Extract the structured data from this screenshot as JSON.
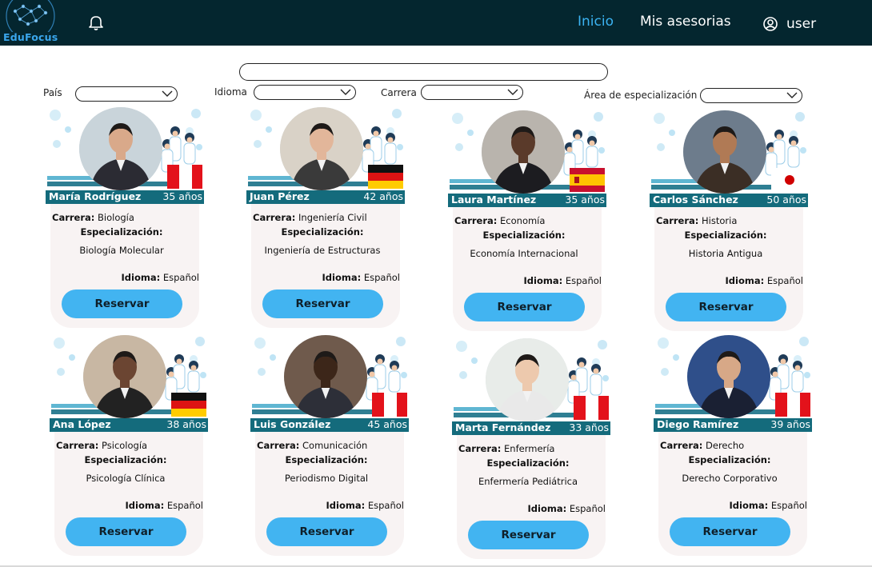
{
  "app": {
    "logo_text": "EduFocus"
  },
  "nav": {
    "inicio": "Inicio",
    "mis_asesorias": "Mis asesorias",
    "user": "user"
  },
  "search": {
    "value": "",
    "placeholder": ""
  },
  "filters": {
    "pais": {
      "label": "País",
      "value": ""
    },
    "idioma": {
      "label": "Idioma",
      "value": ""
    },
    "carrera": {
      "label": "Carrera",
      "value": ""
    },
    "area": {
      "label": "Área de especialización",
      "value": ""
    }
  },
  "labels": {
    "carrera": "Carrera:",
    "especializacion": "Especialización:",
    "idioma": "Idioma:",
    "reservar": "Reservar"
  },
  "colors": {
    "navbar": "#04262f",
    "accent": "#42b4f1",
    "name_bar": "#146b7c",
    "card_bg": "#f8f3f3"
  },
  "advisors": [
    {
      "name": "María Rodríguez",
      "age": "35 años",
      "carrera": "Biología",
      "especializacion": "Biología Molecular",
      "idioma": "Español",
      "flag": "peru",
      "photo_icon": "advisor-photo-icon"
    },
    {
      "name": "Juan Pérez",
      "age": "42 años",
      "carrera": "Ingeniería Civil",
      "especializacion": "Ingeniería de Estructuras",
      "idioma": "Español",
      "flag": "germany",
      "photo_icon": "advisor-photo-icon"
    },
    {
      "name": "Laura Martínez",
      "age": "35 años",
      "carrera": "Economía",
      "especializacion": "Economía Internacional",
      "idioma": "Español",
      "flag": "spain",
      "photo_icon": "advisor-photo-icon"
    },
    {
      "name": "Carlos Sánchez",
      "age": "50 años",
      "carrera": "Historia",
      "especializacion": "Historia Antigua",
      "idioma": "Español",
      "flag": "japan",
      "photo_icon": "advisor-photo-icon"
    },
    {
      "name": "Ana López",
      "age": "38 años",
      "carrera": "Psicología",
      "especializacion": "Psicología Clínica",
      "idioma": "Español",
      "flag": "germany",
      "photo_icon": "advisor-photo-icon"
    },
    {
      "name": "Luis González",
      "age": "45 años",
      "carrera": "Comunicación",
      "especializacion": "Periodismo Digital",
      "idioma": "Español",
      "flag": "peru",
      "photo_icon": "advisor-photo-icon"
    },
    {
      "name": "Marta Fernández",
      "age": "33 años",
      "carrera": "Enfermería",
      "especializacion": "Enfermería Pediátrica",
      "idioma": "Español",
      "flag": "peru",
      "photo_icon": "advisor-photo-icon"
    },
    {
      "name": "Diego Ramírez",
      "age": "39 años",
      "carrera": "Derecho",
      "especializacion": "Derecho Corporativo",
      "idioma": "Español",
      "flag": "peru",
      "photo_icon": "advisor-photo-icon"
    }
  ]
}
